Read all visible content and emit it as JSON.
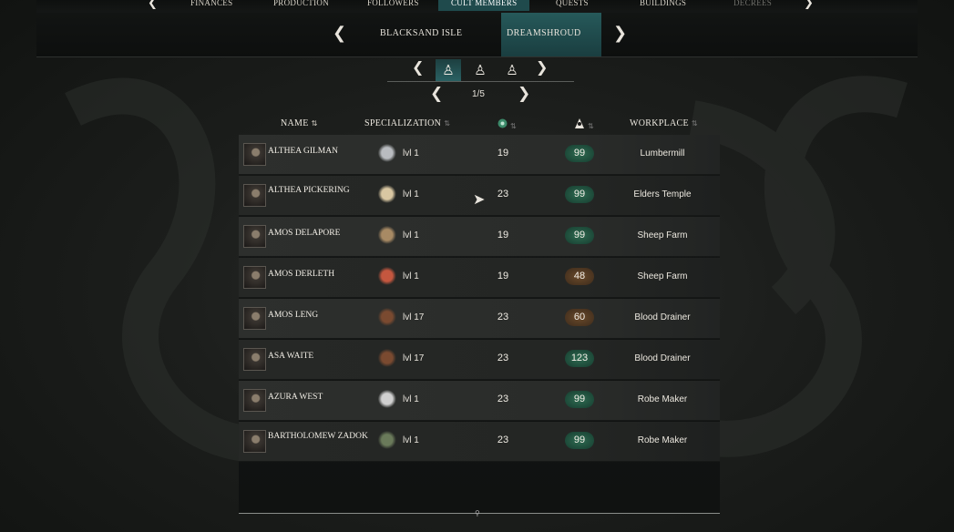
{
  "top_nav": {
    "tabs": [
      {
        "label": "FINANCES"
      },
      {
        "label": "PRODUCTION"
      },
      {
        "label": "FOLLOWERS"
      },
      {
        "label": "CULT MEMBERS"
      },
      {
        "label": "QUESTS"
      },
      {
        "label": "BUILDINGS"
      },
      {
        "label": "DECREES"
      }
    ],
    "active_tab": "CULT MEMBERS"
  },
  "islands": {
    "items": [
      {
        "label": "BLACKSAND ISLE"
      },
      {
        "label": "DREAMSHROUD"
      }
    ],
    "active": "DREAMSHROUD"
  },
  "filters": {
    "icons": [
      "worker-filter-icon",
      "worker-filter-icon",
      "worker-filter-icon"
    ]
  },
  "pager": {
    "text": "1/5"
  },
  "headers": {
    "name": "NAME",
    "specialization": "SPECIALIZATION",
    "sanity_icon": "sanity-icon",
    "cultist_icon": "cultist-icon",
    "workplace": "WORKPLACE"
  },
  "members": [
    {
      "name": "ALTHEA GILMAN",
      "spec_icon": "silver-ingots-icon",
      "level": "lvl 1",
      "stat": "19",
      "loyalty": "99",
      "loyalty_color": "#2f6b52",
      "workplace": "Lumbermill"
    },
    {
      "name": "ALTHEA PICKERING",
      "spec_icon": "wool-icon",
      "level": "lvl 1",
      "stat": "23",
      "loyalty": "99",
      "loyalty_color": "#2f6b52",
      "workplace": "Elders Temple"
    },
    {
      "name": "AMOS DELAPORE",
      "spec_icon": "planks-icon",
      "level": "lvl 1",
      "stat": "19",
      "loyalty": "99",
      "loyalty_color": "#2f6b52",
      "workplace": "Sheep Farm"
    },
    {
      "name": "AMOS DERLETH",
      "spec_icon": "meat-icon",
      "level": "lvl 1",
      "stat": "19",
      "loyalty": "48",
      "loyalty_color": "#6a4a2a",
      "workplace": "Sheep Farm"
    },
    {
      "name": "AMOS LENG",
      "spec_icon": "blood-barrels-icon",
      "level": "lvl 17",
      "stat": "23",
      "loyalty": "60",
      "loyalty_color": "#6a4a2a",
      "workplace": "Blood Drainer"
    },
    {
      "name": "ASA WAITE",
      "spec_icon": "blood-barrels-icon",
      "level": "lvl 17",
      "stat": "23",
      "loyalty": "123",
      "loyalty_color": "#2f6b52",
      "workplace": "Blood Drainer"
    },
    {
      "name": "AZURA WEST",
      "spec_icon": "stone-icon",
      "level": "lvl 1",
      "stat": "23",
      "loyalty": "99",
      "loyalty_color": "#2f6b52",
      "workplace": "Robe Maker"
    },
    {
      "name": "BARTHOLOMEW ZADOK",
      "spec_icon": "barrel-icon",
      "level": "lvl 1",
      "stat": "23",
      "loyalty": "99",
      "loyalty_color": "#2f6b52",
      "workplace": "Robe Maker"
    }
  ]
}
